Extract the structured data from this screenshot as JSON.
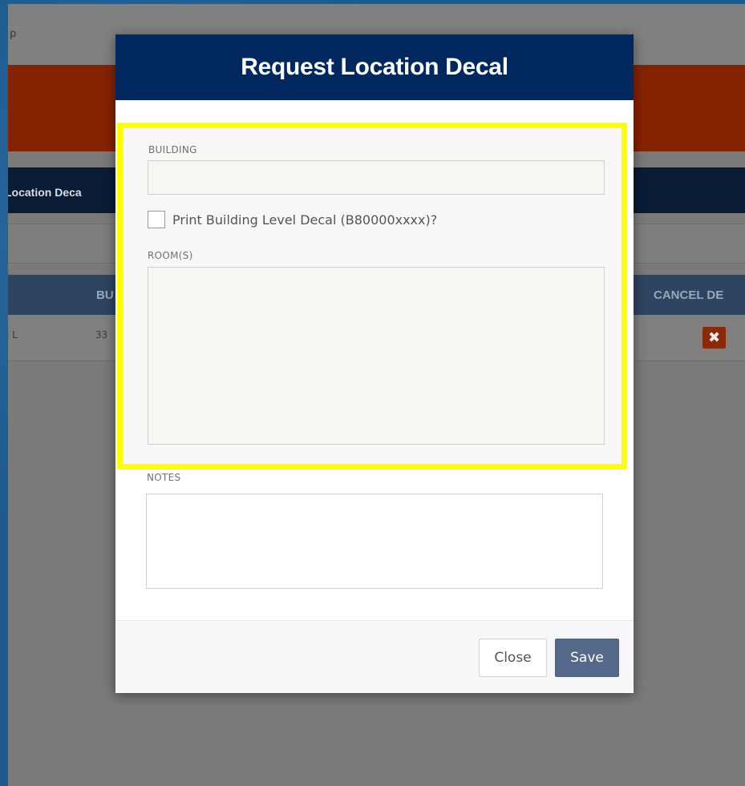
{
  "background": {
    "breadcrumb_fragment": "p",
    "tab_label_fragment": "Location Deca",
    "table_headers": {
      "col_bu": "BU",
      "col_cancel": "CANCEL DE"
    },
    "row": {
      "cell1": "i L",
      "cell2": "33"
    },
    "cancel_icon": "close-icon",
    "colors": {
      "orange_band": "#852300",
      "navy_band": "#0a1b36",
      "table_header": "#2d4561"
    }
  },
  "modal": {
    "title": "Request Location Decal",
    "header_color": "#00285f",
    "highlight_color": "#ffff00",
    "building_label": "BUILDING",
    "building_value": "",
    "checkbox_label": "Print Building Level Decal (B80000xxxx)?",
    "checkbox_checked": false,
    "rooms_label": "ROOM(S)",
    "rooms_value": "",
    "notes_label": "NOTES",
    "notes_value": "",
    "close_label": "Close",
    "save_label": "Save",
    "save_color": "#556a8a"
  }
}
